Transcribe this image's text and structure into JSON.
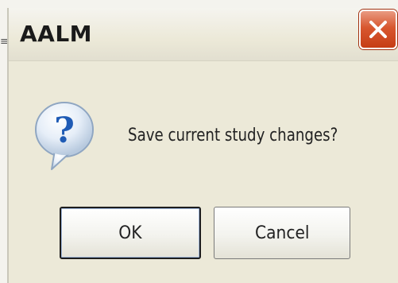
{
  "dialog": {
    "title": "AALM",
    "message": "Save current study changes?",
    "icon": "question-icon",
    "buttons": {
      "ok_label": "OK",
      "cancel_label": "Cancel"
    },
    "close_icon": "close-icon"
  },
  "colors": {
    "close_button": "#d8572f",
    "dialog_background": "#ece9d8",
    "question_icon_blue": "#1f5bb5"
  }
}
